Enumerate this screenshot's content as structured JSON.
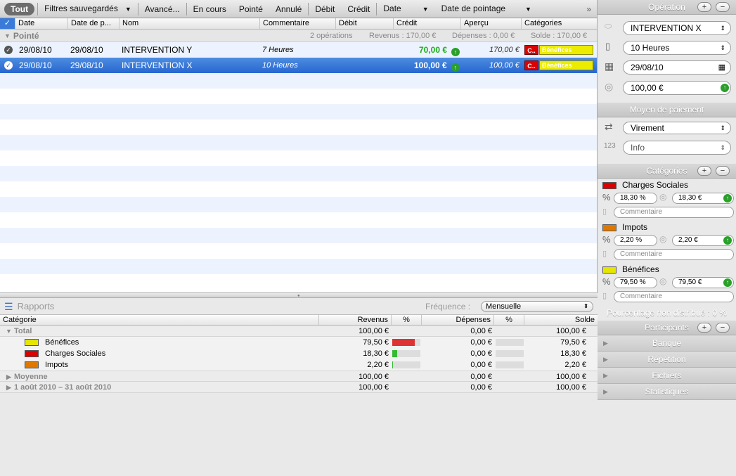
{
  "filterbar": {
    "all": "Tout",
    "saved": "Filtres sauvegardés",
    "advanced": "Avancé...",
    "pending": "En cours",
    "cleared": "Pointé",
    "cancelled": "Annulé",
    "debit": "Débit",
    "credit": "Crédit",
    "date": "Date",
    "clear_date": "Date de pointage",
    "more": "»"
  },
  "columns": {
    "check": "✓",
    "date": "Date",
    "date_p": "Date de p...",
    "name": "Nom",
    "comment": "Commentaire",
    "debit": "Débit",
    "credit": "Crédit",
    "preview": "Aperçu",
    "categories": "Catégories"
  },
  "group": {
    "title": "Pointé",
    "count": "2 opérations",
    "income": "Revenus : 170,00 €",
    "expenses": "Dépenses : 0,00 €",
    "balance": "Solde : 170,00 €"
  },
  "rows": [
    {
      "date": "29/08/10",
      "date_p": "29/08/10",
      "name": "INTERVENTION Y",
      "comment": "7 Heures",
      "credit": "70,00 €",
      "preview": "170,00 €",
      "cat_short": "C..",
      "cat_label": "Bénéfices"
    },
    {
      "date": "29/08/10",
      "date_p": "29/08/10",
      "name": "INTERVENTION X",
      "comment": "10 Heures",
      "credit": "100,00 €",
      "preview": "100,00 €",
      "cat_short": "C..",
      "cat_label": "Bénéfices"
    }
  ],
  "reports": {
    "title": "Rapports",
    "freq_label": "Fréquence :",
    "freq_value": "Mensuelle",
    "headers": {
      "category": "Catégorie",
      "income": "Revenus",
      "pct": "%",
      "expenses": "Dépenses",
      "pct2": "%",
      "balance": "Solde"
    },
    "total": {
      "label": "Total",
      "income": "100,00 €",
      "expenses": "0,00 €",
      "balance": "100,00 €"
    },
    "items": [
      {
        "label": "Bénéfices",
        "color": "#e6e600",
        "income": "79,50 €",
        "pct": 79.5,
        "expenses": "0,00 €",
        "balance": "79,50 €"
      },
      {
        "label": "Charges Sociales",
        "color": "#dd0000",
        "income": "18,30 €",
        "pct": 18.3,
        "expenses": "0,00 €",
        "balance": "18,30 €"
      },
      {
        "label": "Impots",
        "color": "#e07800",
        "income": "2,20 €",
        "pct": 2.2,
        "expenses": "0,00 €",
        "balance": "2,20 €"
      }
    ],
    "average": {
      "label": "Moyenne",
      "income": "100,00 €",
      "expenses": "0,00 €",
      "balance": "100,00 €"
    },
    "period": {
      "label": "1 août 2010 – 31 août 2010",
      "income": "100,00 €",
      "expenses": "0,00 €",
      "balance": "100,00 €"
    }
  },
  "panel": {
    "operation_title": "Opération",
    "name_value": "INTERVENTION X",
    "comment_value": "10 Heures",
    "date_value": "29/08/10",
    "amount_value": "100,00 €",
    "payment_title": "Moyen de paiement",
    "payment_value": "Virement",
    "info_value": "Info",
    "categories_title": "Catégories",
    "cats": [
      {
        "name": "Charges Sociales",
        "color": "#dd0000",
        "pct": "18,30 %",
        "amount": "18,30 €",
        "comment": "Commentaire"
      },
      {
        "name": "Impots",
        "color": "#e07800",
        "pct": "2,20 %",
        "amount": "2,20 €",
        "comment": "Commentaire"
      },
      {
        "name": "Bénéfices",
        "color": "#e6e600",
        "pct": "79,50 %",
        "amount": "79,50 €",
        "comment": "Commentaire"
      }
    ],
    "undistributed": "Pourcentage non distribué : 0 %",
    "participants": "Participants",
    "bank": "Banque",
    "repeat": "Répétition",
    "files": "Fichiers",
    "stats": "Statistiques"
  }
}
